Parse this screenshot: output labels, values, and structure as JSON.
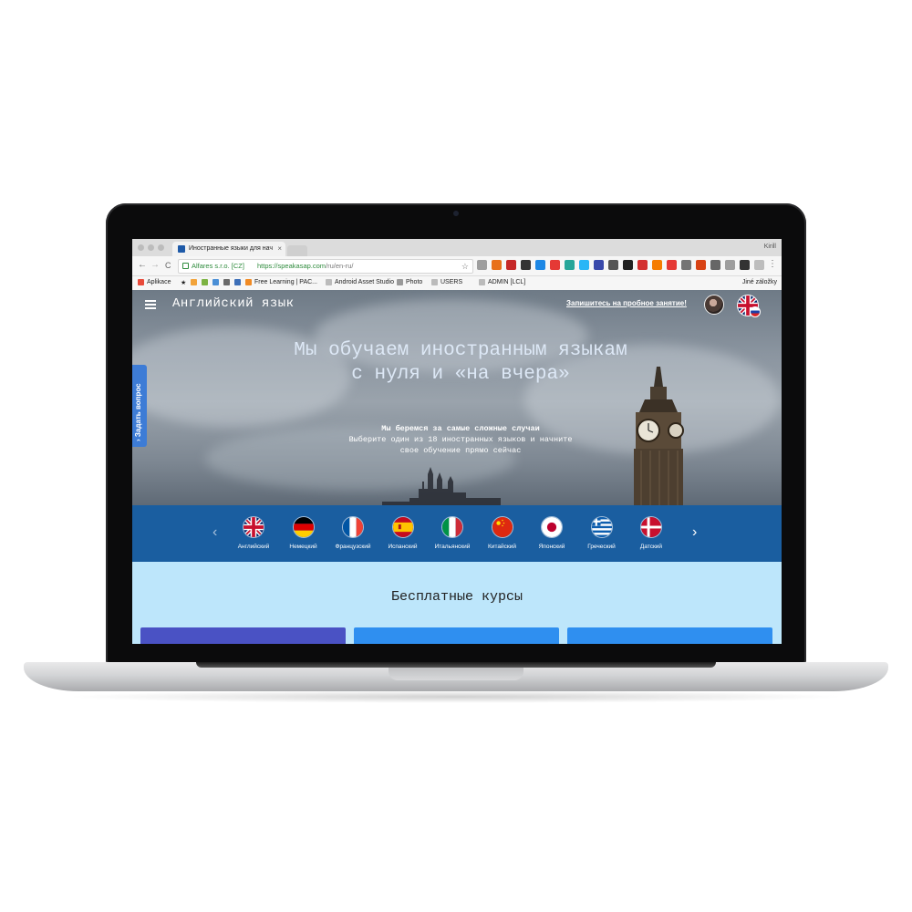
{
  "browser": {
    "tab_title": "Иностранные языки для нач",
    "tab_close": "×",
    "profile_name": "Kirill",
    "cert_owner": "Alfares s.r.o. [CZ]",
    "url_host": "https://speakasap.com",
    "url_path": "/ru/en-ru/",
    "back": "←",
    "forward": "→",
    "reload": "C",
    "star": "☆",
    "menu": "⋮",
    "bookmarks": [
      {
        "label": "Aplikace",
        "icon": "apps-grid-icon",
        "color": "#e84a3a"
      },
      {
        "label": "★",
        "icon": "star-icon",
        "color": "#333333"
      },
      {
        "label": "",
        "icon": "bookmark-icon",
        "color": "#f2a33a"
      },
      {
        "label": "",
        "icon": "android-icon",
        "color": "#7cb342"
      },
      {
        "label": "",
        "icon": "bookmark-icon",
        "color": "#4a8fd6"
      },
      {
        "label": "",
        "icon": "bookmark-icon",
        "color": "#6a6a6a"
      },
      {
        "label": "",
        "icon": "bookmark-icon",
        "color": "#3d6fb8"
      },
      {
        "label": "Free Learning | PAC...",
        "icon": "packt-icon",
        "color": "#f08a24"
      },
      {
        "label": "Android Asset Studio",
        "icon": "page-icon",
        "color": "#bbbbbb"
      },
      {
        "label": "Photo",
        "icon": "folder-icon",
        "color": "#999999"
      },
      {
        "label": "USERS",
        "icon": "page-icon",
        "color": "#bbbbbb"
      },
      {
        "label": "ADMIN [LCL]",
        "icon": "page-icon",
        "color": "#bbbbbb"
      }
    ],
    "other_bookmarks": "Jiné záložky",
    "extension_colors": [
      "#9e9e9e",
      "#e8701a",
      "#c62828",
      "#333333",
      "#1e88e5",
      "#e53935",
      "#26a69a",
      "#29b6f6",
      "#3949ab",
      "#555555",
      "#212121",
      "#d32f2f",
      "#f57c00",
      "#e53935",
      "#757575",
      "#d84315",
      "#666666",
      "#9e9e9e",
      "#333333",
      "#bdbdbd"
    ]
  },
  "site": {
    "title": "Английский язык",
    "trial_link": "Запишитесь на пробное занятие!",
    "side_tab": "Задать вопрос",
    "side_tab_chevron": "›",
    "hero": {
      "title_line1": "Мы обучаем иностранным языкам",
      "title_line2": "с нуля и «на вчера»",
      "subtitle_bold": "Мы беремся за самые сложные случаи",
      "subtitle_line1": "Выберите один из 18 иностранных языков и начните",
      "subtitle_line2": "свое обучение прямо сейчас"
    },
    "carousel": {
      "prev": "‹",
      "next": "›",
      "languages": [
        {
          "label": "Английский",
          "flag": "uk-flag-icon"
        },
        {
          "label": "Немецкий",
          "flag": "german-flag-icon"
        },
        {
          "label": "Французский",
          "flag": "french-flag-icon"
        },
        {
          "label": "Испанский",
          "flag": "spanish-flag-icon"
        },
        {
          "label": "Итальянский",
          "flag": "italian-flag-icon"
        },
        {
          "label": "Китайский",
          "flag": "chinese-flag-icon"
        },
        {
          "label": "Японский",
          "flag": "japanese-flag-icon"
        },
        {
          "label": "Греческий",
          "flag": "greek-flag-icon"
        },
        {
          "label": "Датский",
          "flag": "danish-flag-icon"
        }
      ]
    },
    "courses": {
      "title": "Бесплатные курсы",
      "card_colors": [
        "#4a52c4",
        "#2f8ff0",
        "#2f8ff0"
      ]
    },
    "colors": {
      "band": "#1a5ea0",
      "courses_bg": "#bde6fb",
      "side_tab": "#3d7cd6"
    }
  }
}
